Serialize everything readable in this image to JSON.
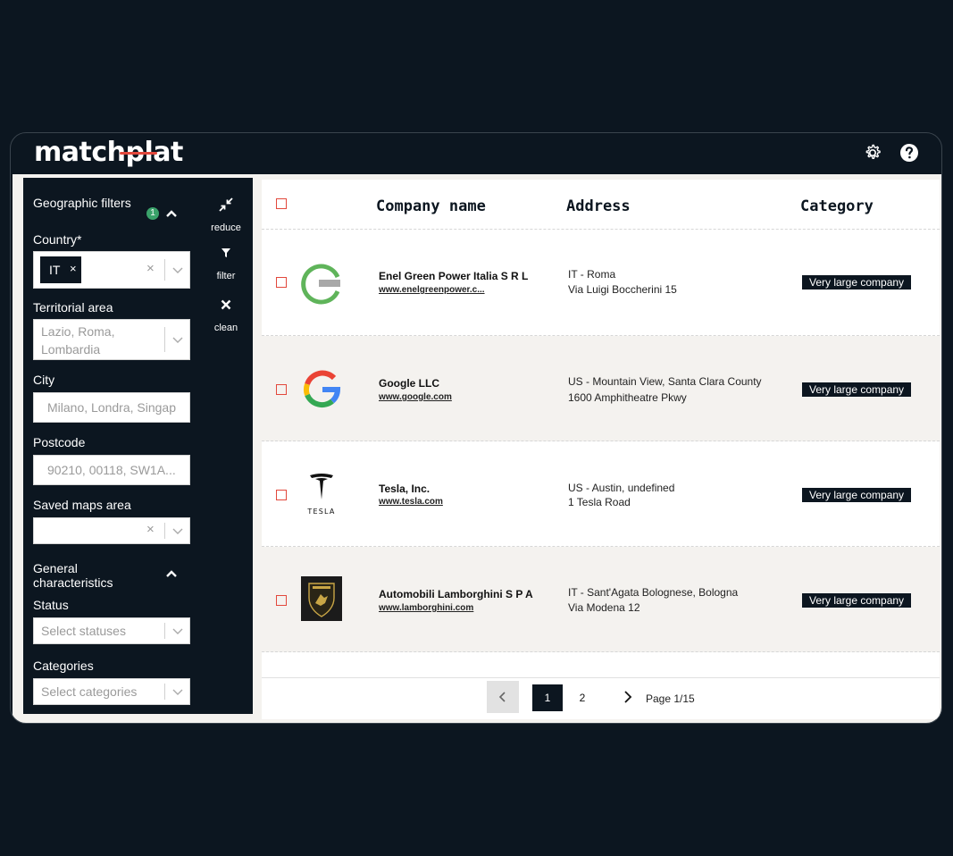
{
  "app": {
    "brand": "matchplat"
  },
  "filters": {
    "geo_title": "Geographic filters",
    "geo_count": "1",
    "country_label": "Country*",
    "country_chip": "IT",
    "chip_remove": "×",
    "clear_symbol": "×",
    "territorial_label": "Territorial area",
    "territorial_placeholder": "Lazio, Roma, Lombardia",
    "city_label": "City",
    "city_placeholder": "Milano, Londra, Singap",
    "postcode_label": "Postcode",
    "postcode_placeholder": "90210, 00118, SW1A...",
    "saved_label": "Saved maps area",
    "general_title": "General characteristics",
    "status_label": "Status",
    "status_placeholder": "Select statuses",
    "categories_label": "Categories",
    "categories_placeholder": "Select categories"
  },
  "tools": {
    "reduce": "reduce",
    "filter": "filter",
    "clean": "clean"
  },
  "table": {
    "headers": {
      "name": "Company name",
      "address": "Address",
      "category": "Category"
    },
    "rows": [
      {
        "name": "Enel Green Power Italia S R L",
        "url": "www.enelgreenpower.c...",
        "addr1": "IT - Roma",
        "addr2": "Via Luigi Boccherini 15",
        "category": "Very large company",
        "logo": "enel-logo"
      },
      {
        "name": "Google LLC",
        "url": "www.google.com",
        "addr1": "US - Mountain View, Santa Clara County",
        "addr2": "1600 Amphitheatre Pkwy",
        "category": "Very large company",
        "logo": "google-logo"
      },
      {
        "name": "Tesla, Inc.",
        "url": "www.tesla.com",
        "addr1": "US - Austin, undefined",
        "addr2": "1 Tesla Road",
        "category": "Very large company",
        "logo": "tesla-logo"
      },
      {
        "name": "Automobili Lamborghini S P A",
        "url": "www.lamborghini.com",
        "addr1": "IT - Sant'Agata Bolognese, Bologna",
        "addr2": "Via Modena 12",
        "category": "Very large company",
        "logo": "lamborghini-logo"
      }
    ]
  },
  "pagination": {
    "page1": "1",
    "page2": "2",
    "info": "Page 1/15"
  },
  "logos": {
    "tesla_wordmark": "TESLA"
  },
  "colors": {
    "dark": "#0c1620",
    "accent": "#e2483c",
    "badge": "#3aa26a"
  }
}
